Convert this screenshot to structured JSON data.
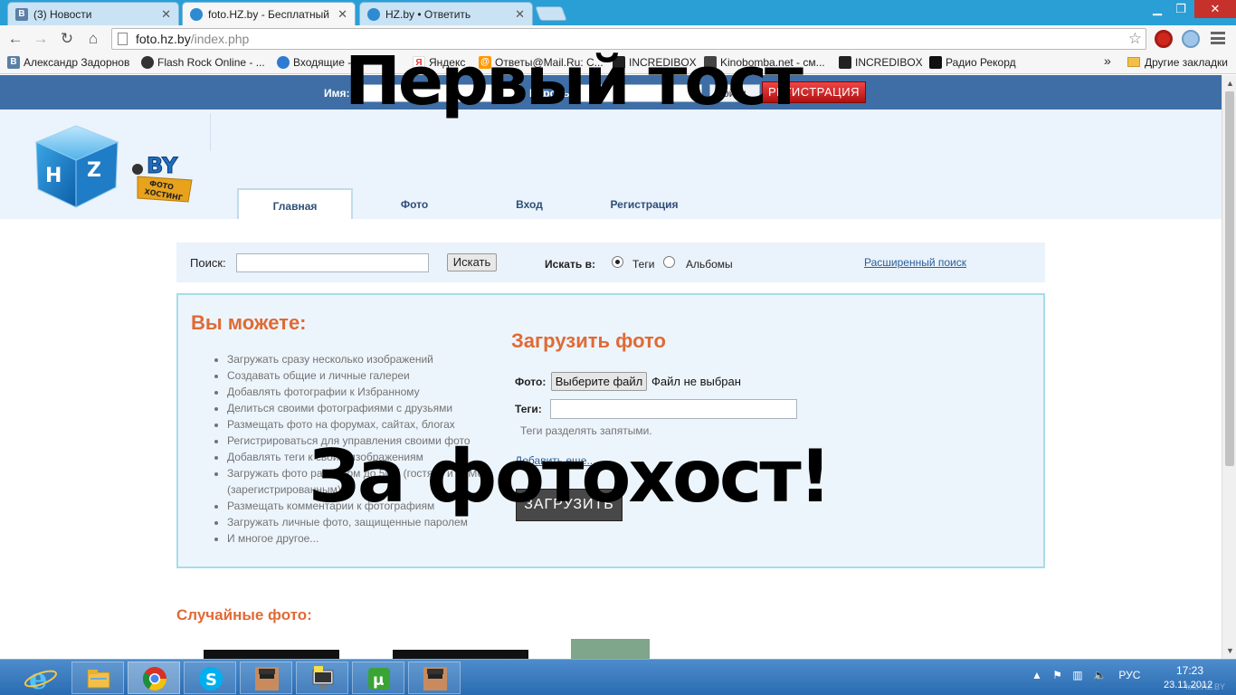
{
  "tabs": [
    {
      "favicon": "vk-icon",
      "title": "(3) Новости",
      "active": false
    },
    {
      "favicon": "hz-icon",
      "title": "foto.HZ.by - Бесплатный",
      "active": true
    },
    {
      "favicon": "hz-icon",
      "title": "HZ.by • Ответить",
      "active": false
    }
  ],
  "address": {
    "host": "foto.hz.by",
    "path": "/index.php"
  },
  "bookmarks": [
    {
      "icon": "vk-icon",
      "label": "Александр Задорнов",
      "color": "#5b7fa6"
    },
    {
      "icon": "skull-icon",
      "label": "Flash Rock Online - ...",
      "color": "#333333"
    },
    {
      "icon": "mail-icon",
      "label": "Входящие - ...",
      "color": "#2f7bd3"
    },
    {
      "icon": "yandex-icon",
      "label": "Яндекс",
      "color": "#e33"
    },
    {
      "icon": "mailru-icon",
      "label": "Ответы@Mail.Ru: С...",
      "color": "#f90"
    },
    {
      "icon": "cube-icon",
      "label": "INCREDIBOX",
      "color": "#222"
    },
    {
      "icon": "film-icon",
      "label": "Kinobomba.net - см...",
      "color": "#444"
    },
    {
      "icon": "cube-icon",
      "label": "INCREDIBOX",
      "color": "#222"
    },
    {
      "icon": "record-icon",
      "label": "Радио Рекорд",
      "color": "#111"
    }
  ],
  "bookmarks_more": "»",
  "bookmarks_other": "Другие закладки",
  "site": {
    "login": {
      "name_label": "Имя:",
      "pass_label": "Пароль:",
      "enter": "Войти",
      "register": "РЕГИСТРАЦИЯ"
    },
    "logo_text": "HZ BY",
    "logo_sub": "ФОТО ХОСТИНГ",
    "nav": [
      "Главная",
      "Фото",
      "Вход",
      "Регистрация"
    ],
    "search": {
      "label": "Поиск:",
      "button": "Искать",
      "in_label": "Искать в:",
      "options": [
        "Теги",
        "Альбомы"
      ],
      "selected": "Теги",
      "advanced": "Расширенный поиск"
    },
    "can_title": "Вы можете:",
    "features": [
      "Загружать сразу несколько изображений",
      "Создавать общие и личные галереи",
      "Добавлять фотографии к Избранному",
      "Делиться своими фотографиями с друзьями",
      "Размещать фото на форумах, сайтах, блогах",
      "Регистрироваться для управления своими фото",
      "Добавлять теги к своим изображениям",
      "Загружать фото размером до 5Мб (гостям) и 10Мб (зарегистрированным)",
      "Размещать комментарии к фотографиям",
      "Загружать личные фото, защищенные паролем",
      "И многое другое..."
    ],
    "upload": {
      "title": "Загрузить фото",
      "photo_label": "Фото:",
      "file_button": "Выберите файл",
      "file_status": "Файл не выбран",
      "tags_label": "Теги:",
      "tags_hint": "Теги разделять запятыми.",
      "add_more": "Добавить еще...",
      "submit": "ЗАГРУЗИТЬ"
    },
    "random_title": "Случайные фото:"
  },
  "meme": {
    "top": "Первый тост",
    "bottom": "За фотохост!"
  },
  "taskbar": {
    "items": [
      "ie-icon",
      "explorer-icon",
      "chrome-icon",
      "skype-icon",
      "avatar-icon",
      "computer-icon",
      "utorrent-icon",
      "avatar-icon"
    ],
    "active_index": 2,
    "tray_lang": "РУС",
    "time": "17:23",
    "date": "23.11.2012"
  },
  "watermark": "foto.HZ.BY",
  "colors": {
    "accent_orange": "#e06a35",
    "topbar_blue": "#3e6ea5",
    "register_red": "#d02020",
    "link_blue": "#2b5f9a"
  }
}
